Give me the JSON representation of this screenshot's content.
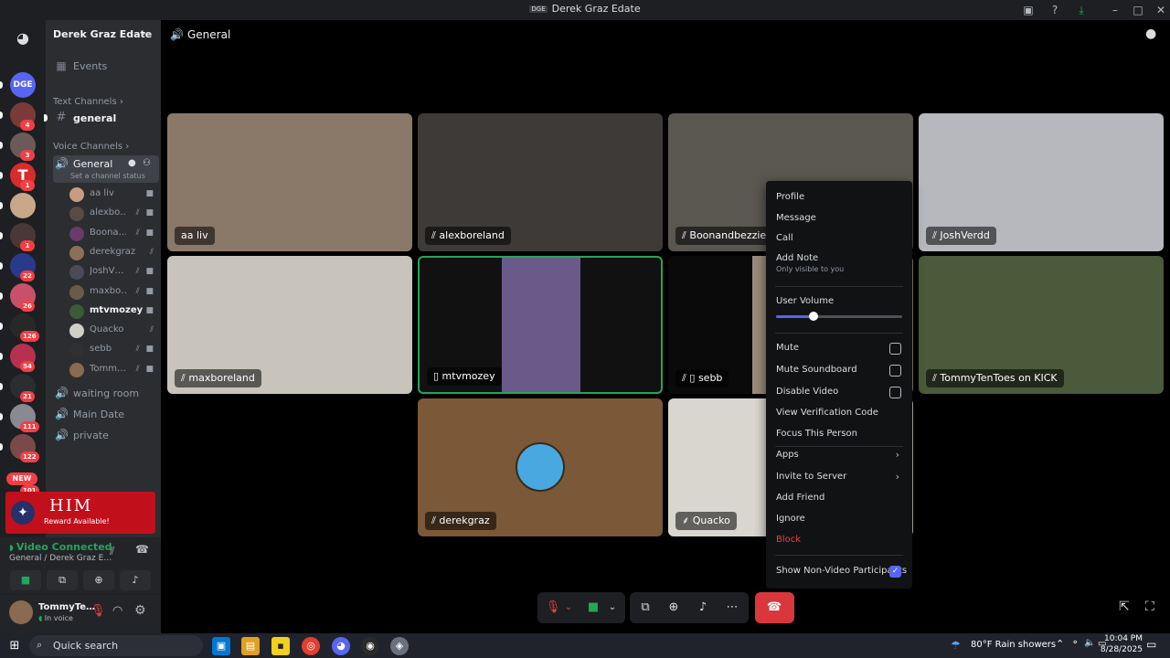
{
  "window": {
    "server_tag": "DGE",
    "title": "Derek Graz Edate"
  },
  "servers": {
    "items": [
      {
        "label": "DGE",
        "badge": ""
      },
      {
        "label": "",
        "badge": "4"
      },
      {
        "label": "",
        "badge": "3"
      },
      {
        "label": "T",
        "badge": "1"
      },
      {
        "label": "",
        "badge": ""
      },
      {
        "label": "",
        "badge": "1"
      },
      {
        "label": "",
        "badge": "22"
      },
      {
        "label": "",
        "badge": "26"
      },
      {
        "label": "",
        "badge": "126"
      },
      {
        "label": "",
        "badge": "54"
      },
      {
        "label": "",
        "badge": "21"
      },
      {
        "label": "",
        "badge": "111"
      },
      {
        "label": "",
        "badge": "122"
      }
    ],
    "new_badge": "NEW",
    "last_badge": "101"
  },
  "sidebar": {
    "server_name": "Derek Graz Edate",
    "events_label": "Events",
    "text_category": "Text Channels",
    "general_text": "general",
    "voice_category": "Voice Channels",
    "voice_general": "General",
    "channel_status": "Set a channel status",
    "voice_users": [
      {
        "name": "aa liv",
        "color": "#c89c80"
      },
      {
        "name": "alexbo…",
        "color": "#5a4a44"
      },
      {
        "name": "Boona…",
        "color": "#6a3a6a"
      },
      {
        "name": "derekgraz",
        "color": "#8a7058"
      },
      {
        "name": "JoshV…",
        "color": "#4a4a58"
      },
      {
        "name": "maxbo…",
        "color": "#6a5a4a"
      },
      {
        "name": "mtvmozey",
        "color": "#3a5a3a"
      },
      {
        "name": "Quacko",
        "color": "#d0d0c8"
      },
      {
        "name": "sebb",
        "color": "#303034"
      },
      {
        "name": "Tomm…",
        "color": "#8a6a50"
      }
    ],
    "other_channels": [
      "waiting room",
      "Main Date",
      "private"
    ]
  },
  "promo": {
    "title": "HIM",
    "subtitle": "Reward Available!"
  },
  "voice_panel": {
    "status": "Video Connected",
    "location": "General / Derek Graz E…"
  },
  "user_panel": {
    "name": "TommyTe…",
    "status": "In voice"
  },
  "main": {
    "channel_name": "General",
    "tiles": [
      {
        "name": "aa liv",
        "bg": "#8a7868"
      },
      {
        "name": "alexboreland",
        "bg": "#3e3a38"
      },
      {
        "name": "Boonandbezzie",
        "bg": "#5a5650"
      },
      {
        "name": "JoshVerdd",
        "bg": "#b6b8be"
      },
      {
        "name": "maxboreland",
        "bg": "#c8c4bc"
      },
      {
        "name": "mtvmozey",
        "bg": "#111111"
      },
      {
        "name": "sebb",
        "bg": "#0a0a0a"
      },
      {
        "name": "TommyTenToes on KICK",
        "bg": "#4a5a3a"
      },
      {
        "name": "derekgraz",
        "bg": "#7a5838"
      },
      {
        "name": "Quacko",
        "bg": "#d8d6ce"
      }
    ]
  },
  "context_menu": {
    "profile": "Profile",
    "message": "Message",
    "call": "Call",
    "add_note": "Add Note",
    "add_note_sub": "Only visible to you",
    "user_volume": "User Volume",
    "user_volume_level": 0.3,
    "mute": "Mute",
    "mute_soundboard": "Mute Soundboard",
    "disable_video": "Disable Video",
    "view_verification": "View Verification Code",
    "focus": "Focus This Person",
    "apps": "Apps",
    "invite": "Invite to Server",
    "add_friend": "Add Friend",
    "ignore": "Ignore",
    "block": "Block",
    "show_non_video": "Show Non-Video Participants",
    "show_non_video_checked": true
  },
  "taskbar": {
    "search": "Quick search",
    "weather": "80°F  Rain showers",
    "time": "10:04 PM",
    "date": "8/28/2025"
  }
}
